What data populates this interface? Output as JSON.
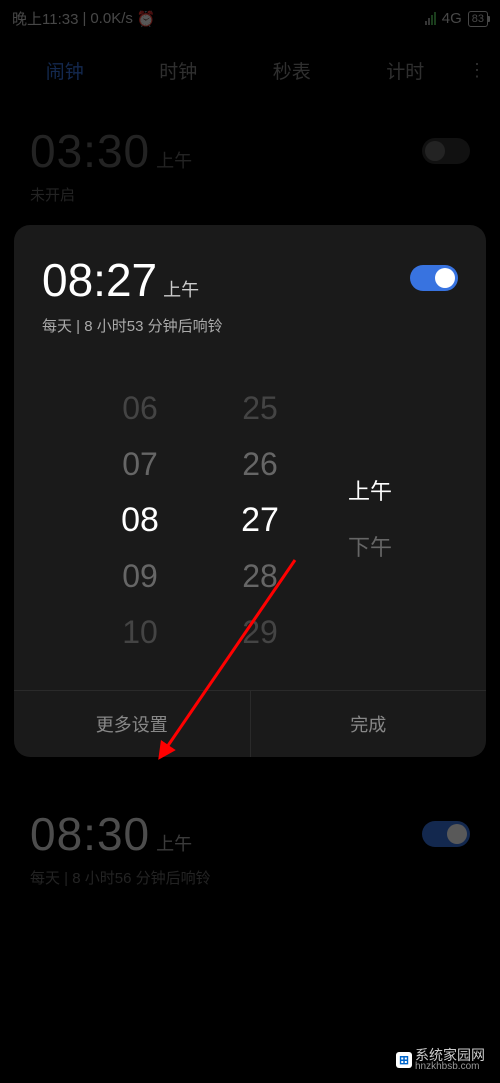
{
  "status": {
    "time": "晚上11:33",
    "speed": "0.0K/s",
    "network": "4G",
    "battery": "83"
  },
  "tabs": {
    "alarm": "闹钟",
    "clock": "时钟",
    "stopwatch": "秒表",
    "timer": "计时"
  },
  "alarm1": {
    "time": "03:30",
    "ampm": "上午",
    "sub": "未开启"
  },
  "expanded": {
    "time": "08:27",
    "ampm": "上午",
    "sub": "每天 | 8 小时53 分钟后响铃",
    "picker": {
      "hours": [
        "06",
        "07",
        "08",
        "09",
        "10"
      ],
      "minutes": [
        "25",
        "26",
        "27",
        "28",
        "29"
      ],
      "am": "上午",
      "pm": "下午"
    },
    "more": "更多设置",
    "done": "完成"
  },
  "alarm2": {
    "time": "08:30",
    "ampm": "上午",
    "sub": "每天 | 8 小时56 分钟后响铃"
  },
  "watermark": {
    "title": "系统家园网",
    "url": "hnzkhbsb.com"
  }
}
